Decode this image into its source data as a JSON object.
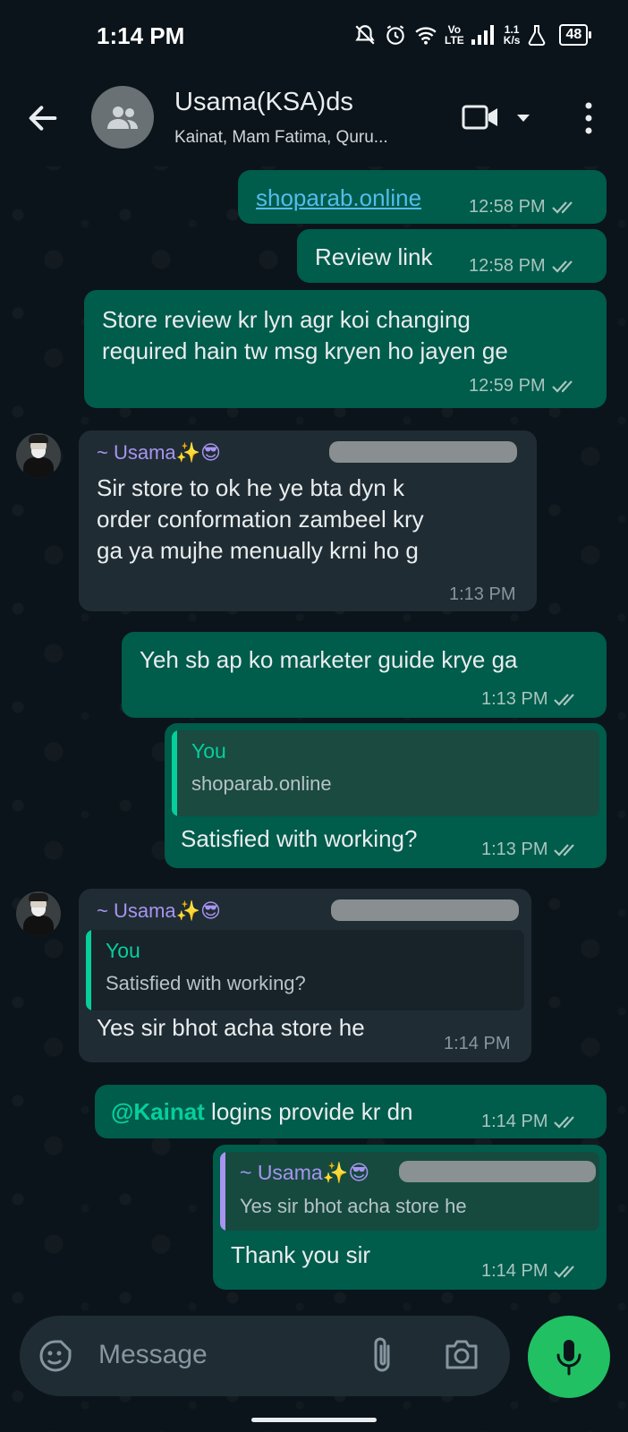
{
  "status": {
    "time": "1:14 PM",
    "lte_top": "Vo",
    "lte_bottom": "LTE",
    "speed_top": "1.1",
    "speed_bottom": "K/s",
    "battery": "48"
  },
  "header": {
    "title": "Usama(KSA)ds",
    "subtitle": "Kainat, Mam Fatima, Quru..."
  },
  "messages": [
    {
      "type": "out",
      "link": "shoparab.online",
      "time": "12:58 PM"
    },
    {
      "type": "out",
      "text": "Review link",
      "time": "12:58 PM"
    },
    {
      "type": "out",
      "lines": [
        "Store review kr lyn agr koi changing",
        "required hain tw msg kryen ho jayen ge"
      ],
      "time": "12:59 PM"
    },
    {
      "type": "in",
      "sender": "~ Usama✨😎",
      "lines": [
        "Sir store to ok he ye bta dyn k",
        "order conformation zambeel kry",
        "ga ya mujhe menually krni ho g"
      ],
      "time": "1:13 PM"
    },
    {
      "type": "out",
      "text": "Yeh sb ap ko marketer guide krye ga",
      "time": "1:13 PM"
    },
    {
      "type": "out",
      "quote_name": "You",
      "quote_text": "shoparab.online",
      "text": "Satisfied with working?",
      "time": "1:13 PM"
    },
    {
      "type": "in",
      "sender": "~ Usama✨😎",
      "quote_name": "You",
      "quote_text": "Satisfied with working?",
      "text": "Yes sir bhot acha store he",
      "time": "1:14 PM"
    },
    {
      "type": "out",
      "mention": "@Kainat",
      "text": " logins provide kr dn",
      "time": "1:14 PM"
    },
    {
      "type": "out",
      "quote_name": "~ Usama✨😎",
      "quote_text": "Yes sir bhot acha store he",
      "text": "Thank you sir",
      "time": "1:14 PM"
    }
  ],
  "input": {
    "placeholder": "Message"
  },
  "colors": {
    "background": "#0b141a",
    "outgoing_bubble": "#005c4b",
    "incoming_bubble": "#202c33",
    "accent_green": "#21c063",
    "link": "#53bdeb",
    "sender_name": "#a794f0"
  }
}
